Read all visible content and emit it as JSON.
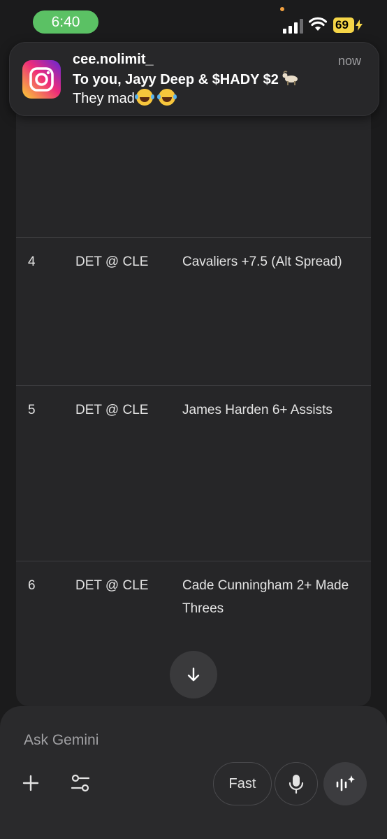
{
  "status_bar": {
    "time": "6:40",
    "battery": "69",
    "icons": [
      "signal-icon",
      "wifi-icon",
      "battery-charging-icon"
    ]
  },
  "notification": {
    "app_icon": "instagram-icon",
    "sender": "cee.nolimit_",
    "message_line1": "To you, Jayy Deep & $HADY $2",
    "message_line2": "They mad",
    "time": "now"
  },
  "table": {
    "rows": [
      {
        "num": "4",
        "game": "DET @ CLE",
        "bet": "Cavaliers +7.5 (Alt Spread)"
      },
      {
        "num": "5",
        "game": "DET @ CLE",
        "bet": "James Harden 6+ Assists"
      },
      {
        "num": "6",
        "game": "DET @ CLE",
        "bet": "Cade Cunningham 2+ Made Threes"
      }
    ]
  },
  "input": {
    "placeholder": "Ask Gemini",
    "mode_label": "Fast",
    "icons": [
      "plus-icon",
      "tools-icon",
      "microphone-icon",
      "live-icon",
      "arrow-down-icon"
    ]
  },
  "colors": {
    "time_pill": "#5bc164",
    "battery": "#f5d547",
    "background": "#1b1b1c",
    "card": "#262628",
    "panel": "#2a2a2c"
  }
}
